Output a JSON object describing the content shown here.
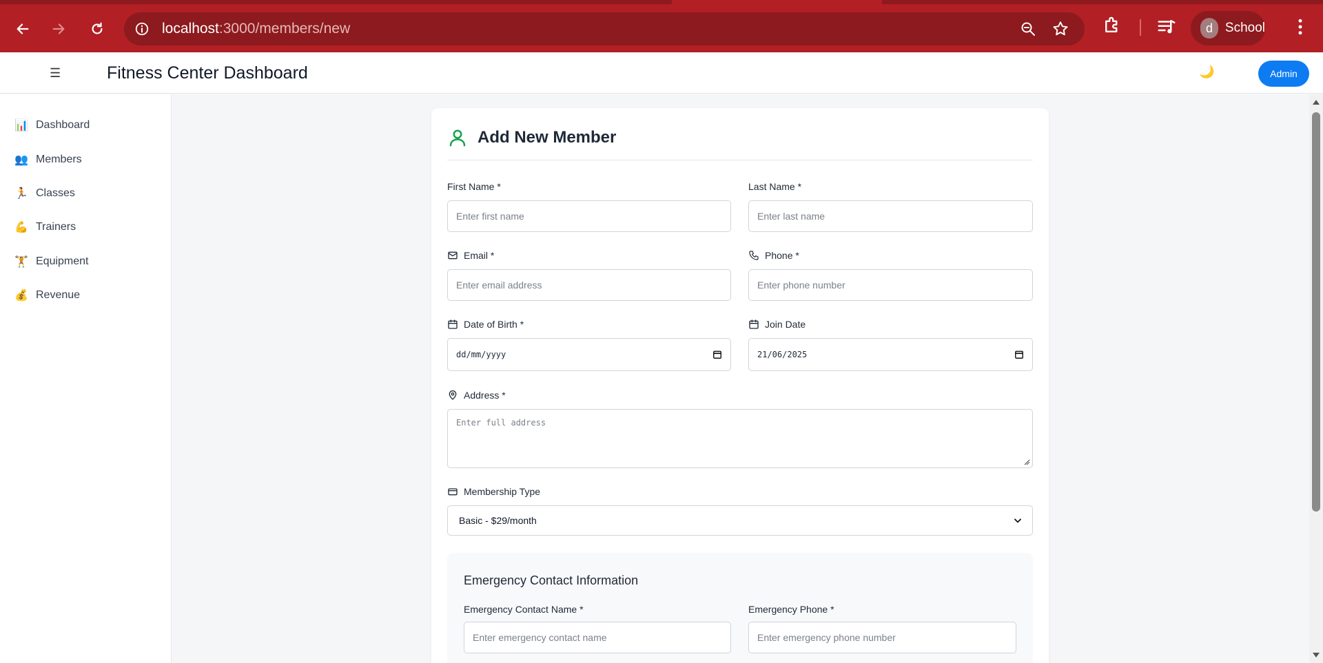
{
  "browser": {
    "url_host": "localhost",
    "url_path": ":3000/members/new",
    "profile_initial": "d",
    "profile_name": "School"
  },
  "header": {
    "menu_icon": "☰",
    "title": "Fitness Center Dashboard",
    "theme_icon": "🌙",
    "admin_label": "Admin"
  },
  "sidebar": {
    "items": [
      {
        "icon": "📊",
        "label": "Dashboard"
      },
      {
        "icon": "👥",
        "label": "Members"
      },
      {
        "icon": "🏃",
        "label": "Classes"
      },
      {
        "icon": "💪",
        "label": "Trainers"
      },
      {
        "icon": "🏋",
        "label": "Equipment"
      },
      {
        "icon": "💰",
        "label": "Revenue"
      }
    ]
  },
  "form": {
    "title": "Add New Member",
    "first_name": {
      "label": "First Name *",
      "placeholder": "Enter first name"
    },
    "last_name": {
      "label": "Last Name *",
      "placeholder": "Enter last name"
    },
    "email": {
      "label": "Email *",
      "placeholder": "Enter email address"
    },
    "phone": {
      "label": "Phone *",
      "placeholder": "Enter phone number"
    },
    "dob": {
      "label": "Date of Birth *",
      "value": "dd/mm/yyyy"
    },
    "join_date": {
      "label": "Join Date",
      "value": "21/06/2025"
    },
    "address": {
      "label": "Address *",
      "placeholder": "Enter full address"
    },
    "membership": {
      "label": "Membership Type",
      "value": "Basic - $29/month"
    },
    "emergency": {
      "title": "Emergency Contact Information",
      "name": {
        "label": "Emergency Contact Name *",
        "placeholder": "Enter emergency contact name"
      },
      "phone": {
        "label": "Emergency Phone *",
        "placeholder": "Enter emergency phone number"
      }
    }
  },
  "colors": {
    "browser_frame": "#b21f24",
    "accent": "#0d7cf2",
    "member_icon": "#16a34a"
  }
}
